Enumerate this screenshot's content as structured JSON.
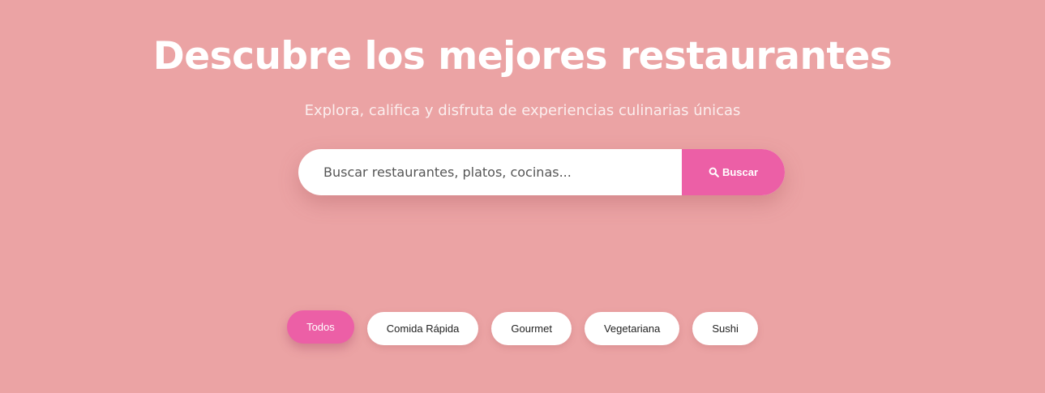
{
  "hero": {
    "title": "Descubre los mejores restaurantes",
    "subtitle": "Explora, califica y disfruta de experiencias culinarias únicas"
  },
  "search": {
    "placeholder": "Buscar restaurantes, platos, cocinas...",
    "value": "",
    "button_label": "Buscar",
    "button_icon": "search-icon"
  },
  "filters": {
    "items": [
      {
        "label": "Todos",
        "active": true
      },
      {
        "label": "Comida Rápida",
        "active": false
      },
      {
        "label": "Gourmet",
        "active": false
      },
      {
        "label": "Vegetariana",
        "active": false
      },
      {
        "label": "Sushi",
        "active": false
      }
    ]
  },
  "colors": {
    "background": "#eba3a4",
    "accent": "#ec5fa6",
    "text_light": "#ffffff"
  }
}
